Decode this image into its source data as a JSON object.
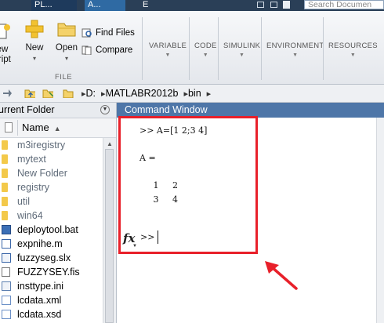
{
  "tabstrip": {
    "tabs": [
      "PL...",
      "A...",
      "E"
    ],
    "search_placeholder": "Search Documen"
  },
  "ribbon": {
    "new_script_label_1": "ew",
    "new_script_label_2": "cript",
    "new_label": "New",
    "open_label": "Open",
    "find_files_label": "Find Files",
    "compare_label": "Compare",
    "file_group_label": "FILE",
    "sections": [
      "VARIABLE",
      "CODE",
      "SIMULINK",
      "ENVIRONMENT",
      "RESOURCES"
    ]
  },
  "address": {
    "path": [
      "D:",
      "MATLABR2012b",
      "bin"
    ]
  },
  "current_folder": {
    "title": "urrent Folder",
    "name_column": "Name",
    "sort_indicator": "▲",
    "items": [
      {
        "name": "m3iregistry",
        "kind": "folder"
      },
      {
        "name": "mytext",
        "kind": "folder"
      },
      {
        "name": "New Folder",
        "kind": "folder"
      },
      {
        "name": "registry",
        "kind": "folder"
      },
      {
        "name": "util",
        "kind": "folder"
      },
      {
        "name": "win64",
        "kind": "folder"
      },
      {
        "name": "deploytool.bat",
        "kind": "bat"
      },
      {
        "name": "expnihe.m",
        "kind": "mfile"
      },
      {
        "name": "fuzzyseg.slx",
        "kind": "slx"
      },
      {
        "name": "FUZZYSEY.fis",
        "kind": "file"
      },
      {
        "name": "insttype.ini",
        "kind": "ini"
      },
      {
        "name": "lcdata.xml",
        "kind": "xml"
      },
      {
        "name": "lcdata.xsd",
        "kind": "xml"
      }
    ]
  },
  "command_window": {
    "title": "Command Window",
    "lines": [
      ">> A=[1 2;3 4]",
      "",
      "A =",
      "",
      "     1     2",
      "     3     4"
    ],
    "fx_symbol": "fx",
    "prompt": ">>"
  },
  "colors": {
    "tabstrip_bg": "#2a3f57",
    "cw_header_bg": "#4e76a8",
    "annotation_red": "#e8202a",
    "folder_yellow": "#f3c94a"
  }
}
